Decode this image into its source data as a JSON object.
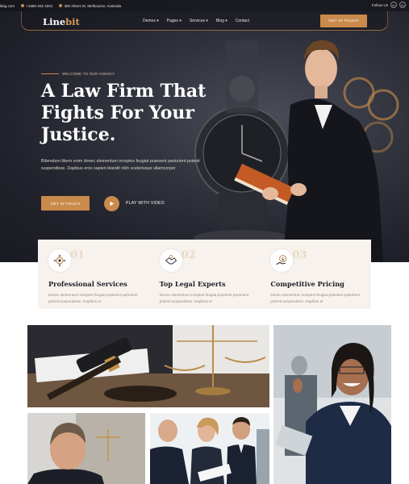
{
  "topbar": {
    "email": "hello@linebit.com",
    "email_visible": "ikkg.com",
    "phone": "+1880 402 1501",
    "address": "380 Albert St, Melbourne, Australia",
    "follow_label": "Follow Us",
    "social": [
      "in",
      "in"
    ]
  },
  "nav": {
    "logo_main": "Line",
    "logo_accent": "bit",
    "menu": [
      "Demos ▾",
      "Pages ▾",
      "Services ▾",
      "Blog ▾",
      "Contact"
    ],
    "cta": "GET IN TOUCH"
  },
  "hero": {
    "tag": "WELCOME TO OUR AGENCY",
    "headline_l1": "A Law Firm That",
    "headline_l2": "Fights For Your",
    "headline_l3": "Justice.",
    "paragraph": "Bibendum libero enim donec elementum inceptos feugiat praesent parturient potenti suspendisse. Dapibus eros sapien blandit nibh scelerisque ullamcorper",
    "btn_primary": "GET IN TOUCH",
    "btn_video": "PLAY WITH VIDEO"
  },
  "features": [
    {
      "num": "01",
      "title": "Professional Services",
      "desc": "Donec elementum inceptos feugiat praesent parturient potenti suspendisse. Dapibus er",
      "icon": "gear-icon"
    },
    {
      "num": "02",
      "title": "Top Legal Experts",
      "desc": "Donec elementum inceptos feugiat praesent parturient potenti suspendisse. Dapibus er",
      "icon": "handshake-icon"
    },
    {
      "num": "03",
      "title": "Competitive Pricing",
      "desc": "Donec elementum inceptos feugiat praesent parturient potenti suspendisse. Dapibus er",
      "icon": "money-icon"
    }
  ],
  "colors": {
    "accent": "#c98a4b",
    "dark": "#1f2029",
    "feature_bg": "#f7f2ed"
  }
}
